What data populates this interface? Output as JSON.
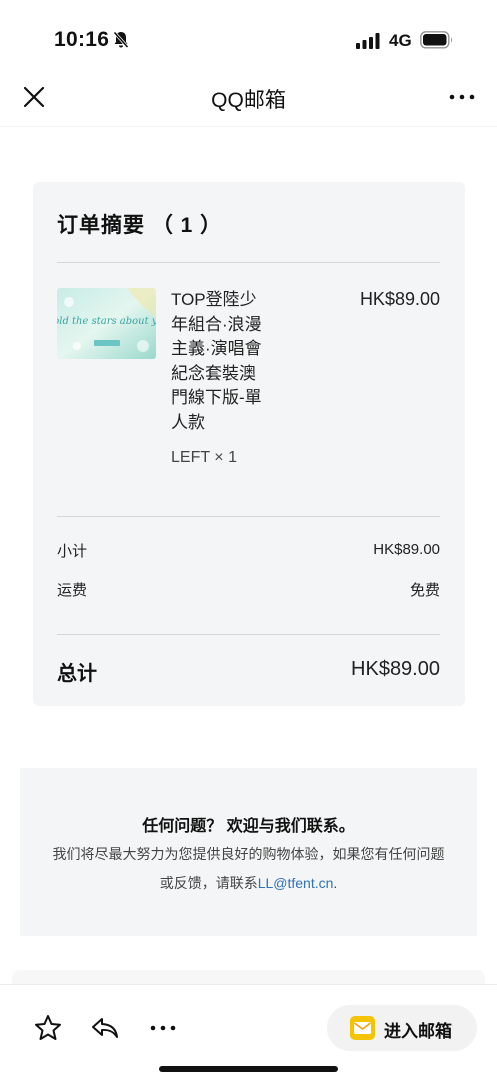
{
  "status_bar": {
    "time": "10:16",
    "network": "4G"
  },
  "nav": {
    "title": "QQ邮箱"
  },
  "order": {
    "title": "订单摘要 （ 1 ）",
    "item": {
      "name": "TOP登陸少年組合·浪漫主義·演唱會紀念套裝澳門線下版-單人款",
      "variant": "LEFT × 1",
      "price": "HK$89.00",
      "thumb_text": "I told the stars about you"
    },
    "subtotal_label": "小计",
    "subtotal_value": "HK$89.00",
    "shipping_label": "运费",
    "shipping_value": "免费",
    "total_label": "总计",
    "total_value": "HK$89.00"
  },
  "help": {
    "title": "任何问题？ 欢迎与我们联系。",
    "text_line1": "我们将尽最大努力为您提供良好的购物体验，如果您有任何问题",
    "text_line2_prefix": "或反馈，请联系",
    "email": "LL@tfent.cn",
    "text_line2_suffix": "."
  },
  "bottom_bar": {
    "open_mail_label": "进入邮箱"
  },
  "colors": {
    "card_bg": "#f4f5f6",
    "link": "#2f72b8",
    "mail_icon": "#f5c400"
  }
}
